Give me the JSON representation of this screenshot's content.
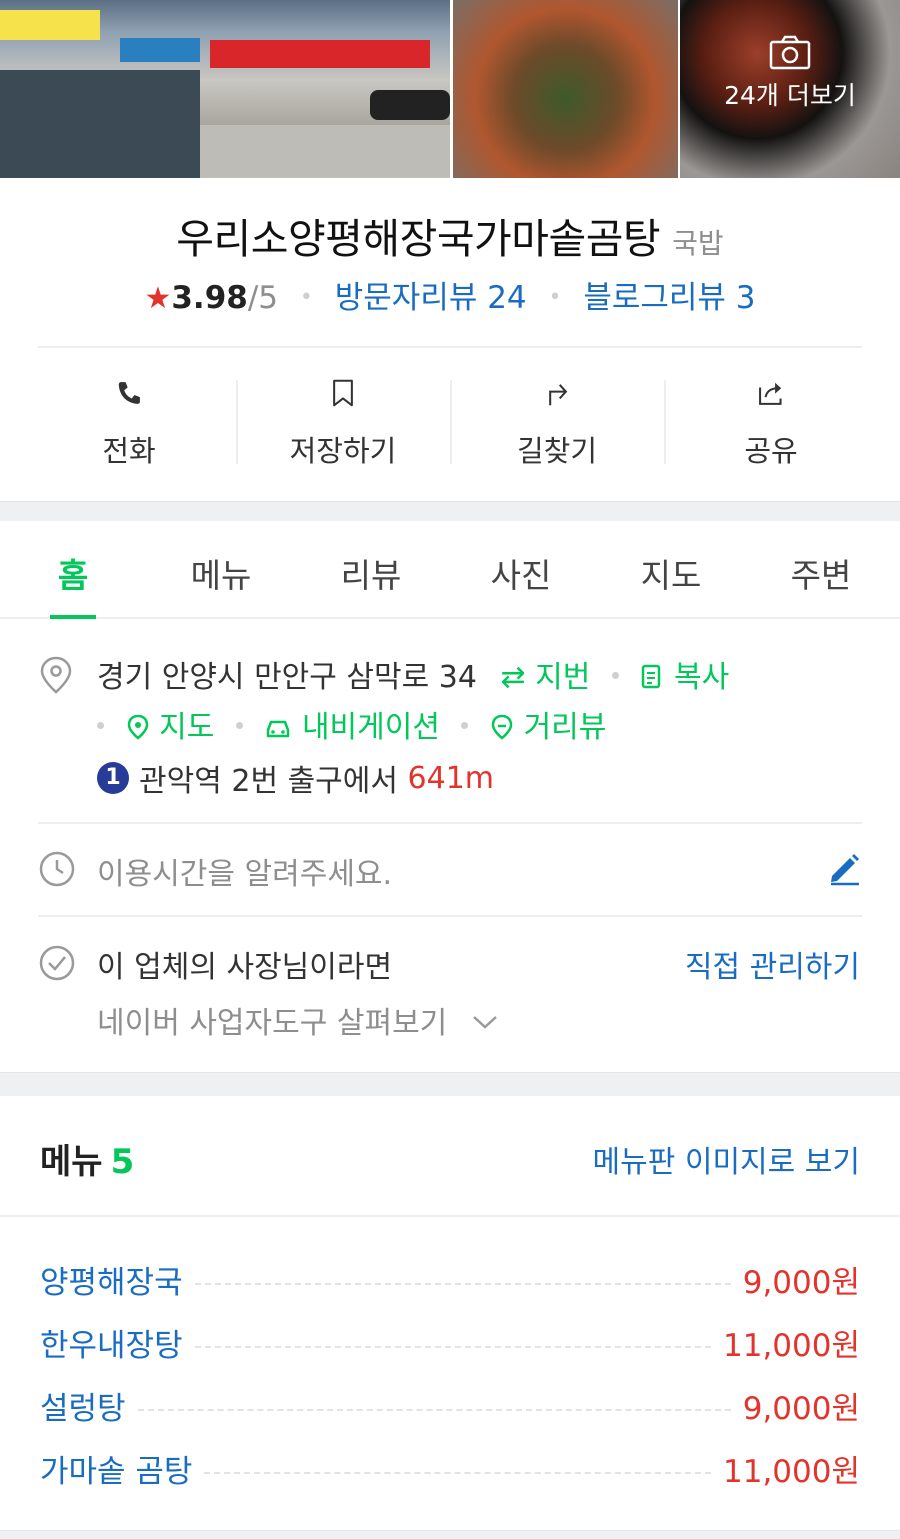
{
  "photos": {
    "more_label": "24개 더보기"
  },
  "place": {
    "name": "우리소양평해장국가마솥곰탕",
    "category": "국밥",
    "rating": "3.98",
    "rating_max": "/5",
    "visitor_reviews": "방문자리뷰 24",
    "blog_reviews": "블로그리뷰 3"
  },
  "actions": [
    {
      "label": "전화",
      "icon": "phone-icon"
    },
    {
      "label": "저장하기",
      "icon": "bookmark-icon"
    },
    {
      "label": "길찾기",
      "icon": "directions-icon"
    },
    {
      "label": "공유",
      "icon": "share-icon"
    }
  ],
  "tabs": [
    "홈",
    "메뉴",
    "리뷰",
    "사진",
    "지도",
    "주변"
  ],
  "info": {
    "address": "경기 안양시 만안구 삼막로 34",
    "jibun": "지번",
    "copy": "복사",
    "map": "지도",
    "navigation": "내비게이션",
    "streetview": "거리뷰",
    "subway_line": "1",
    "station": "관악역",
    "exit": "2번 출구에서",
    "distance": "641m",
    "hours_prompt": "이용시간을 알려주세요.",
    "owner_prompt": "이 업체의 사장님이라면",
    "manage_link": "직접 관리하기",
    "tools_link": "네이버 사업자도구 살펴보기"
  },
  "menu": {
    "title": "메뉴",
    "count": "5",
    "image_link": "메뉴판 이미지로 보기",
    "items": [
      {
        "name": "양평해장국",
        "price": "9,000원"
      },
      {
        "name": "한우내장탕",
        "price": "11,000원"
      },
      {
        "name": "설렁탕",
        "price": "9,000원"
      },
      {
        "name": "가마솥 곰탕",
        "price": "11,000원"
      }
    ]
  },
  "colors": {
    "accent_green": "#03c75a",
    "link_blue": "#1a6cc2",
    "price_red": "#e2342c",
    "line1_blue": "#263c96"
  }
}
